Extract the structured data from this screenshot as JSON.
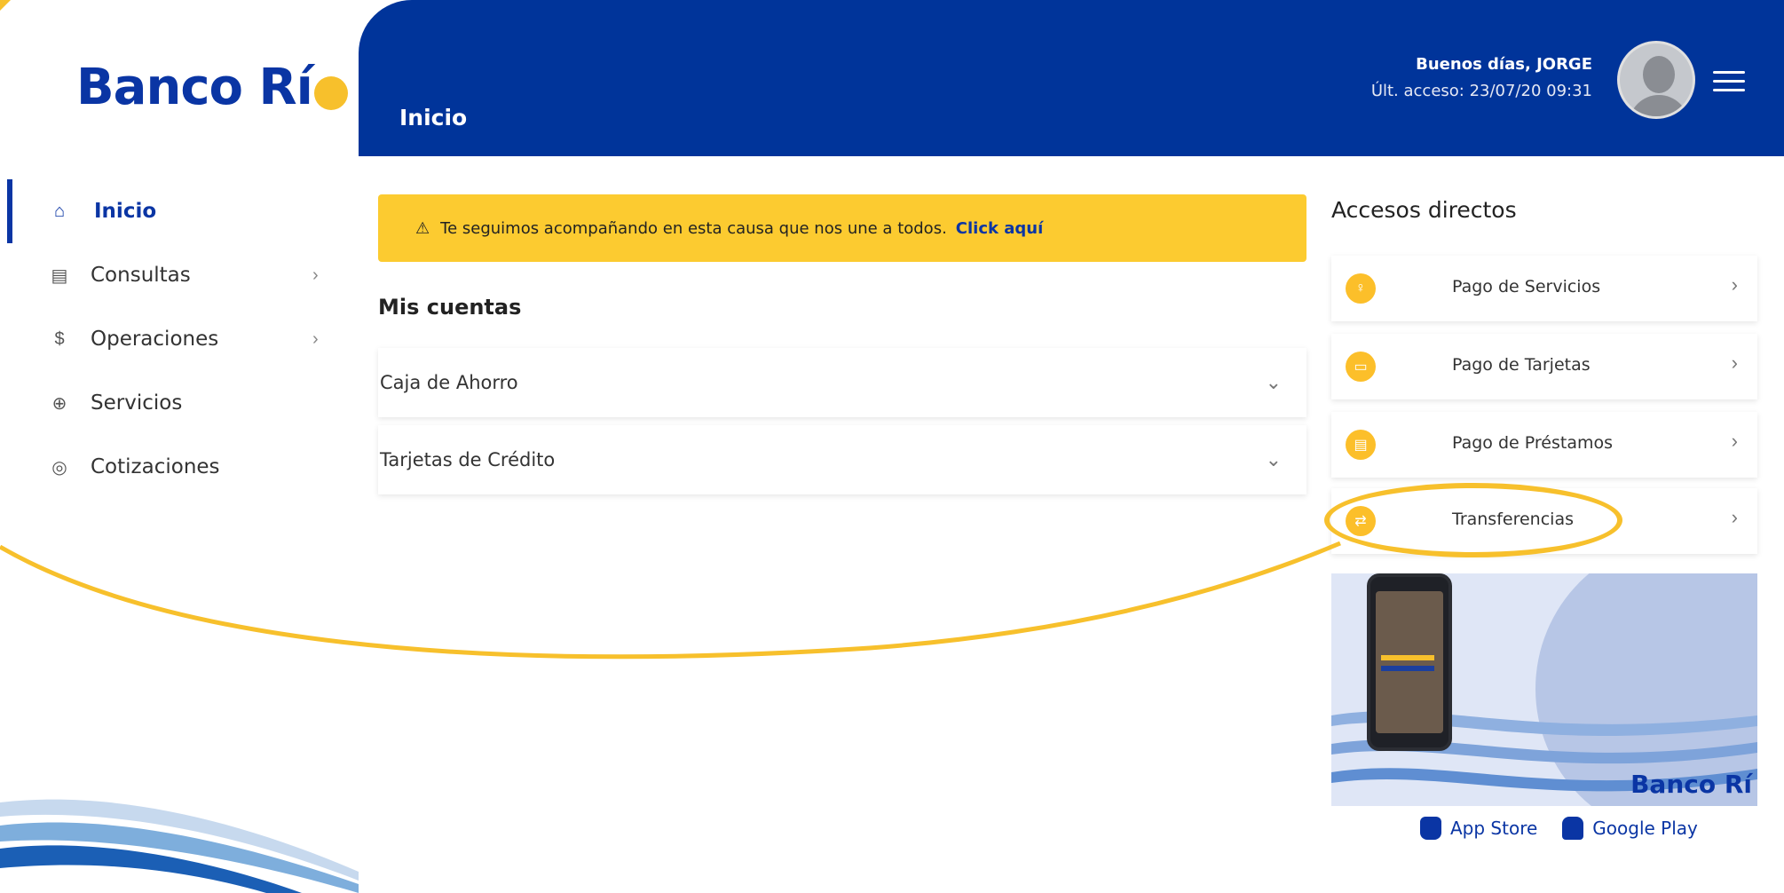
{
  "brand": {
    "name": "Banco Rí",
    "accent": "#f7c02c",
    "primary": "#00349a"
  },
  "header": {
    "title": "Inicio",
    "greeting": "Buenos días, JORGE",
    "last_access": "Últ. acceso: 23/07/20 09:31"
  },
  "sidebar": {
    "items": [
      {
        "label": "Inicio",
        "icon": "home-icon",
        "active": true
      },
      {
        "label": "Consultas",
        "icon": "document-icon"
      },
      {
        "label": "Operaciones",
        "icon": "money-hand-icon"
      },
      {
        "label": "Servicios",
        "icon": "plus-circle-icon"
      },
      {
        "label": "Cotizaciones",
        "icon": "coins-icon"
      }
    ]
  },
  "alert": {
    "text": "Te seguimos acompañando en esta causa que nos une a todos.",
    "link": "Click aquí"
  },
  "accounts": {
    "title": "Mis cuentas",
    "items": [
      {
        "label": "Caja de Ahorro"
      },
      {
        "label": "Tarjetas de Crédito"
      }
    ]
  },
  "shortcuts": {
    "title": "Accesos directos",
    "items": [
      {
        "label": "Pago de Servicios",
        "icon": "lightbulb-icon"
      },
      {
        "label": "Pago de Tarjetas",
        "icon": "card-icon"
      },
      {
        "label": "Pago de Préstamos",
        "icon": "document-icon"
      },
      {
        "label": "Transferencias",
        "icon": "transfer-icon"
      }
    ]
  },
  "banner": {
    "logo": "Banco Rí"
  },
  "stores": {
    "app_store": "App Store",
    "google_play": "Google Play"
  }
}
